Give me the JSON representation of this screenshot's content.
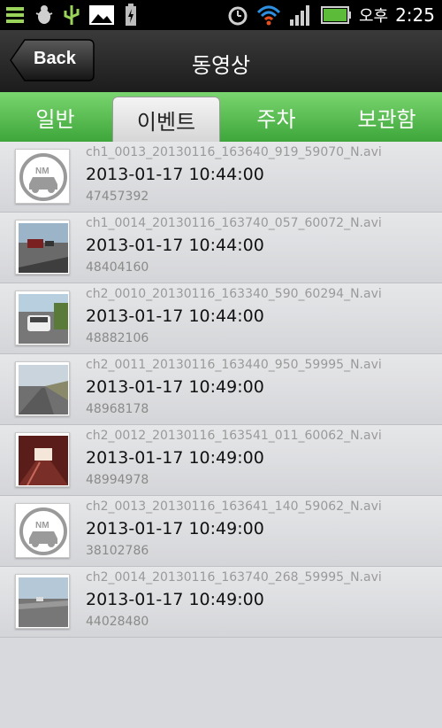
{
  "status_bar": {
    "time": "2:25",
    "ampm": "오후",
    "icons": [
      "menu-icon",
      "bug-icon",
      "usb-icon",
      "image-icon",
      "battery-charging-icon",
      "alarm-icon",
      "wifi-icon",
      "signal-icon",
      "battery-icon"
    ]
  },
  "header": {
    "back_label": "Back",
    "title": "동영상"
  },
  "tabs": [
    {
      "label": "일반",
      "active": false
    },
    {
      "label": "이벤트",
      "active": true
    },
    {
      "label": "주차",
      "active": false
    },
    {
      "label": "보관함",
      "active": false
    }
  ],
  "items": [
    {
      "filename": "ch1_0013_20130116_163640_919_59070_N.avi",
      "datetime": "2013-01-17 10:44:00",
      "size": "47457392",
      "thumb": "no-video-icon"
    },
    {
      "filename": "ch1_0014_20130116_163740_057_60072_N.avi",
      "datetime": "2013-01-17 10:44:00",
      "size": "48404160",
      "thumb": "road-thumbnail"
    },
    {
      "filename": "ch2_0010_20130116_163340_590_60294_N.avi",
      "datetime": "2013-01-17 10:44:00",
      "size": "48882106",
      "thumb": "car-thumbnail"
    },
    {
      "filename": "ch2_0011_20130116_163440_950_59995_N.avi",
      "datetime": "2013-01-17 10:49:00",
      "size": "48968178",
      "thumb": "road-thumbnail"
    },
    {
      "filename": "ch2_0012_20130116_163541_011_60062_N.avi",
      "datetime": "2013-01-17 10:49:00",
      "size": "48994978",
      "thumb": "tunnel-thumbnail"
    },
    {
      "filename": "ch2_0013_20130116_163641_140_59062_N.avi",
      "datetime": "2013-01-17 10:49:00",
      "size": "38102786",
      "thumb": "no-video-icon"
    },
    {
      "filename": "ch2_0014_20130116_163740_268_59995_N.avi",
      "datetime": "2013-01-17 10:49:00",
      "size": "44028480",
      "thumb": "road-thumbnail"
    }
  ],
  "colors": {
    "tab_green": "#4cb548",
    "title_bar": "#262626",
    "list_bg": "#dcdde0"
  }
}
